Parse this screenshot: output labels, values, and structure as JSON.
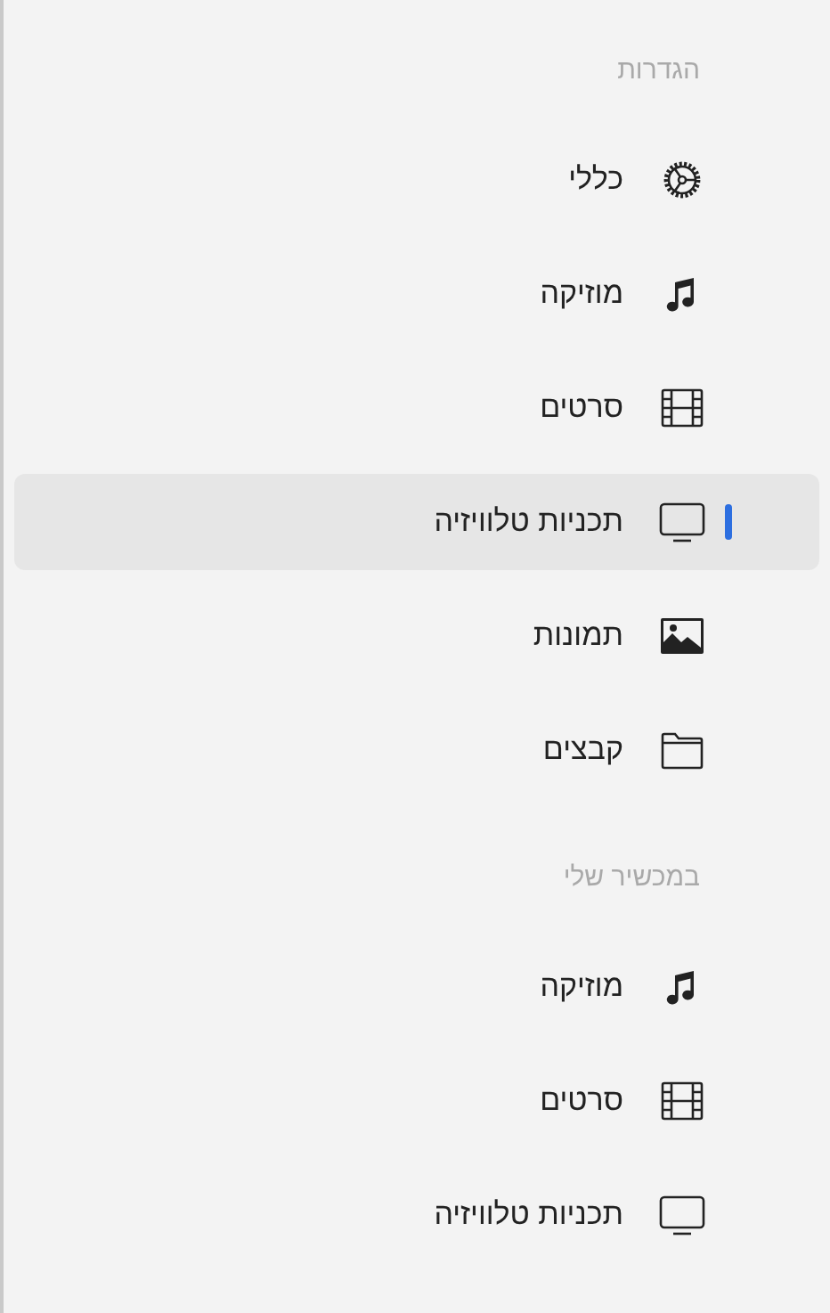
{
  "sections": [
    {
      "title": "הגדרות",
      "items": [
        {
          "label": "כללי",
          "kind": "gear",
          "selected": false
        },
        {
          "label": "מוזיקה",
          "kind": "music",
          "selected": false
        },
        {
          "label": "סרטים",
          "kind": "film",
          "selected": false
        },
        {
          "label": "תכניות טלוויזיה",
          "kind": "tv",
          "selected": true
        },
        {
          "label": "תמונות",
          "kind": "photo",
          "selected": false
        },
        {
          "label": "קבצים",
          "kind": "folder",
          "selected": false
        }
      ]
    },
    {
      "title": "במכשיר שלי",
      "items": [
        {
          "label": "מוזיקה",
          "kind": "music",
          "selected": false
        },
        {
          "label": "סרטים",
          "kind": "film",
          "selected": false
        },
        {
          "label": "תכניות טלוויזיה",
          "kind": "tv",
          "selected": false
        }
      ]
    }
  ]
}
